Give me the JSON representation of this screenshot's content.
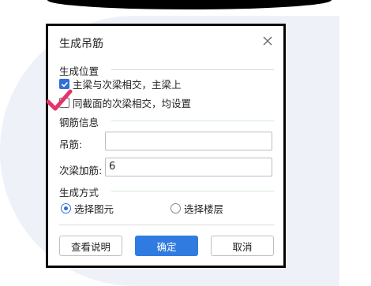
{
  "dialog": {
    "title": "生成吊筋",
    "section_position": "生成位置",
    "option_primary": "主梁与次梁相交，主梁上",
    "option_section": "同截面的次梁相交，均设置",
    "section_rebar": "钢筋信息",
    "hanger_label": "吊筋:",
    "hanger_value": "",
    "stirrup_label": "次梁加筋:",
    "stirrup_value": "6",
    "section_method": "生成方式",
    "radio_select_element": "选择图元",
    "radio_select_floor": "选择楼层",
    "btn_help": "查看说明",
    "btn_ok": "确定",
    "btn_cancel": "取消"
  },
  "colors": {
    "accent": "#2f7be0",
    "annotation_check": "#e5336b"
  }
}
